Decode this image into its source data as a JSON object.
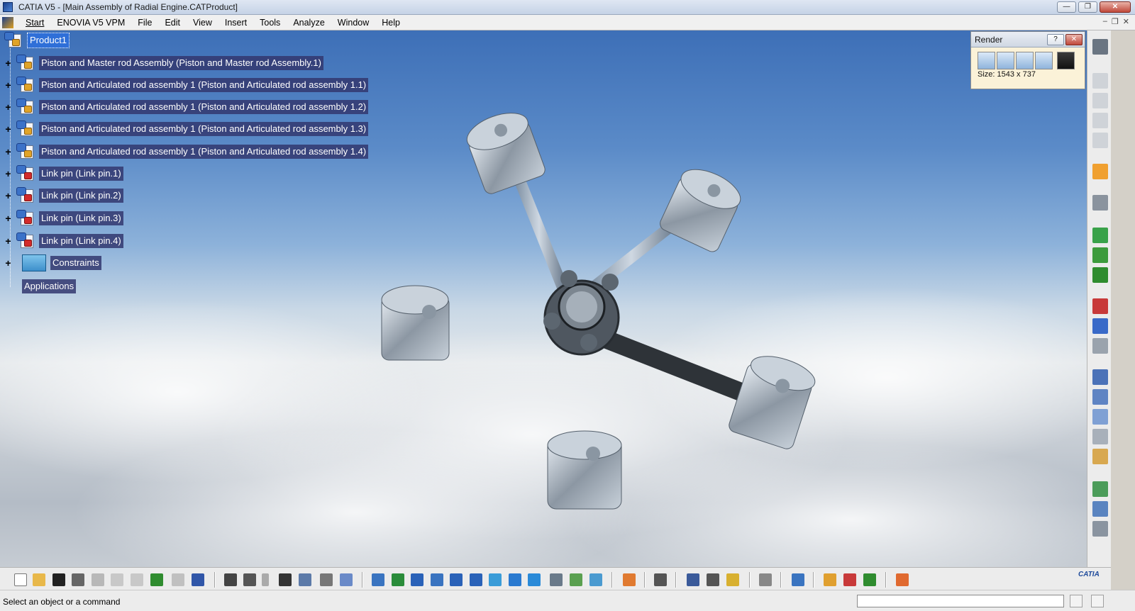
{
  "window": {
    "title": "CATIA V5 - [Main Assembly of Radial Engine.CATProduct]",
    "buttons": {
      "minimize": "—",
      "restore": "❐",
      "close": "✕"
    }
  },
  "menu": {
    "items": [
      "Start",
      "ENOVIA V5 VPM",
      "File",
      "Edit",
      "View",
      "Insert",
      "Tools",
      "Analyze",
      "Window",
      "Help"
    ],
    "mdi": {
      "minimize": "–",
      "restore": "❐",
      "close": "✕"
    }
  },
  "tree": {
    "root": "Product1",
    "children": [
      "Piston and Master rod Assembly (Piston and Master rod Assembly.1)",
      "Piston and Articulated rod assembly 1 (Piston and Articulated rod assembly 1.1)",
      "Piston and Articulated rod assembly 1 (Piston and Articulated rod assembly 1.2)",
      "Piston and Articulated rod assembly 1 (Piston and Articulated rod assembly 1.3)",
      "Piston and Articulated rod assembly 1 (Piston and Articulated rod assembly 1.4)",
      "Link pin (Link pin.1)",
      "Link pin (Link pin.2)",
      "Link pin (Link pin.3)",
      "Link pin (Link pin.4)"
    ],
    "constraints": "Constraints",
    "applications": "Applications"
  },
  "render_panel": {
    "title": "Render",
    "help": "?",
    "close": "✕",
    "size": "Size: 1543 x 737"
  },
  "status": {
    "text": "Select an object or a command",
    "input_value": ""
  },
  "logo": "CATIA"
}
